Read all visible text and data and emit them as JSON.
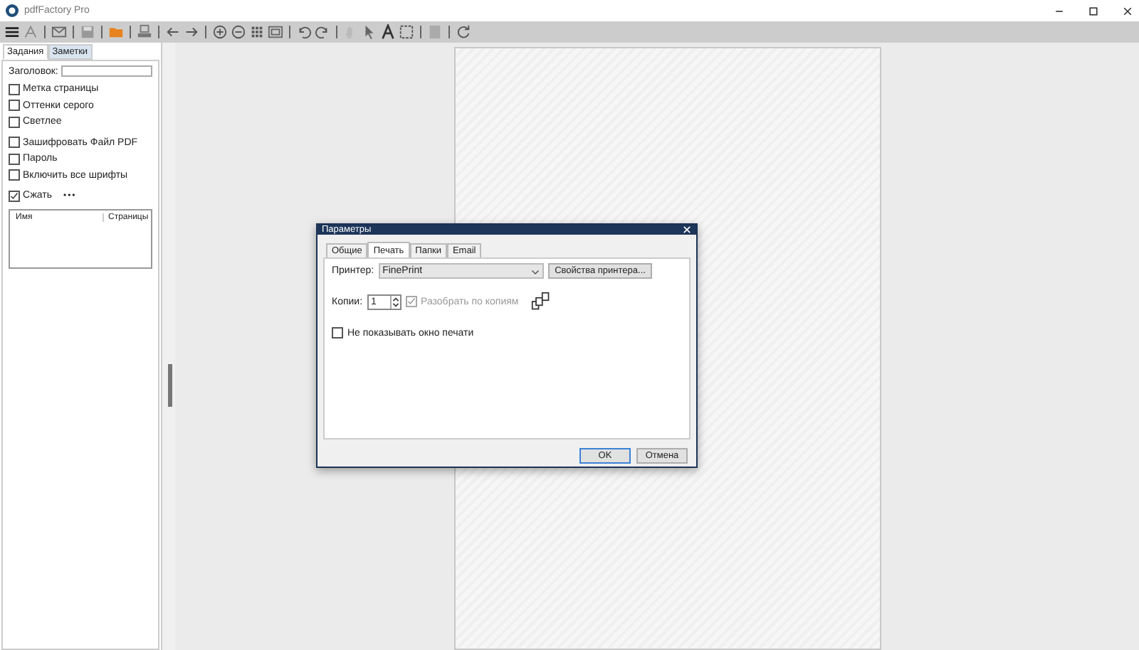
{
  "window": {
    "title": "pdfFactory Pro"
  },
  "sidebar": {
    "tabs": [
      {
        "label": "Задания",
        "selected": true
      },
      {
        "label": "Заметки",
        "selected": false
      }
    ],
    "title_field": {
      "label": "Заголовок:"
    },
    "options": [
      {
        "label": "Метка страницы",
        "checked": false
      },
      {
        "label": "Оттенки серого",
        "checked": false
      },
      {
        "label": "Светлее",
        "checked": false
      },
      {
        "label": "Зашифровать Файл PDF",
        "checked": false
      },
      {
        "label": "Пароль",
        "checked": false
      },
      {
        "label": "Включить все шрифты",
        "checked": false
      },
      {
        "label": "Сжать",
        "checked": true,
        "extra": "•••"
      }
    ],
    "table": {
      "columns": [
        "Имя",
        "Страницы"
      ]
    }
  },
  "dialog": {
    "title": "Параметры",
    "tabs": [
      {
        "label": "Общие",
        "selected": false
      },
      {
        "label": "Печать",
        "selected": true
      },
      {
        "label": "Папки",
        "selected": false
      },
      {
        "label": "Email",
        "selected": false
      }
    ],
    "printer_label": "Принтер:",
    "printer_value": "FinePrint",
    "properties_button": "Свойства принтера...",
    "copies_label": "Копии:",
    "copies_value": "1",
    "collate": {
      "label": "Разобрать по копиям",
      "checked": true,
      "disabled": true
    },
    "hide_window": {
      "label": "Не показывать окно печати",
      "checked": false
    },
    "buttons": [
      {
        "label": "OK",
        "default": true
      },
      {
        "label": "Отмена",
        "default": false
      }
    ]
  }
}
